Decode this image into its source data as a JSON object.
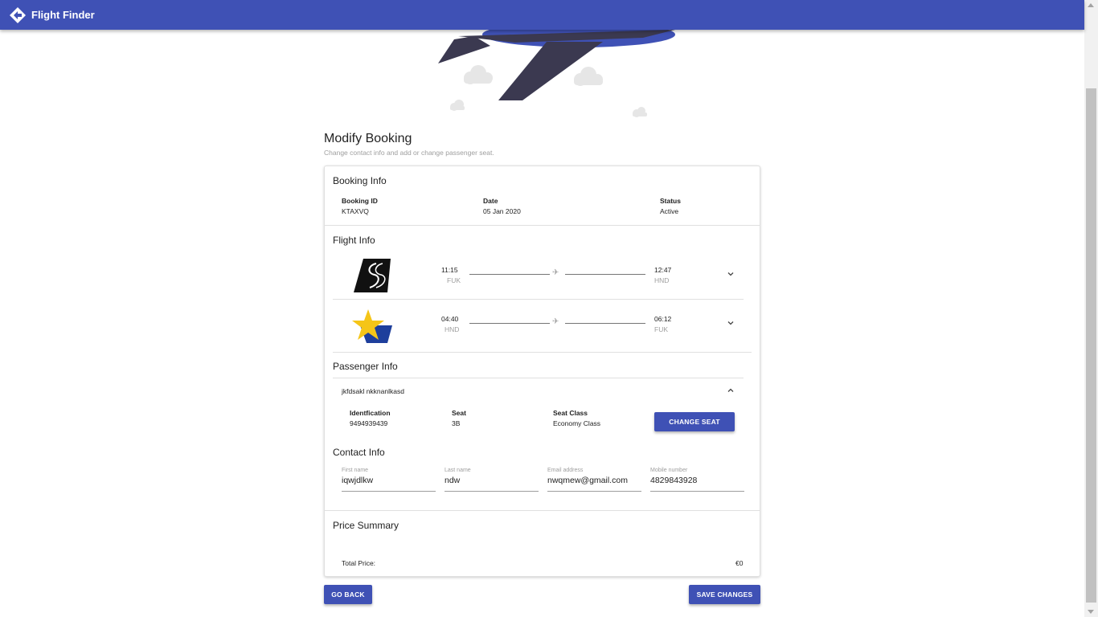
{
  "app": {
    "brand": "Flight Finder"
  },
  "page": {
    "title": "Modify Booking",
    "subtitle": "Change contact info and add or change passenger seat."
  },
  "booking": {
    "section_title": "Booking Info",
    "id_label": "Booking ID",
    "id_value": "KTAXVQ",
    "date_label": "Date",
    "date_value": "05 Jan 2020",
    "status_label": "Status",
    "status_value": "Active"
  },
  "flights": {
    "section_title": "Flight Info",
    "items": [
      {
        "depart_time": "11:15",
        "depart_code": "FUK",
        "arrive_time": "12:47",
        "arrive_code": "HND",
        "logo": "tail-logo-icon"
      },
      {
        "depart_time": "04:40",
        "depart_code": "HND",
        "arrive_time": "06:12",
        "arrive_code": "FUK",
        "logo": "star-logo-icon"
      }
    ]
  },
  "passenger": {
    "section_title": "Passenger Info",
    "name": "jkfdsakl nkknanlkasd",
    "id_label": "Identfication",
    "id_value": "9494939439",
    "seat_label": "Seat",
    "seat_value": "3B",
    "class_label": "Seat Class",
    "class_value": "Economy Class",
    "change_seat_label": "Change Seat"
  },
  "contact": {
    "section_title": "Contact Info",
    "first_name_label": "First name",
    "first_name_value": "iqwjdlkw",
    "last_name_label": "Last name",
    "last_name_value": "ndw",
    "email_label": "Email address",
    "email_value": "nwqmew@gmail.com",
    "mobile_label": "Mobile number",
    "mobile_value": "4829843928"
  },
  "price": {
    "section_title": "Price Summary",
    "total_label": "Total Price:",
    "total_value": "€0"
  },
  "actions": {
    "go_back_label": "Go Back",
    "save_label": "Save Changes"
  },
  "colors": {
    "primary": "#3f51b5",
    "plane_dark": "#3b3950",
    "plane_blue": "#3f51b5",
    "star_yellow": "#f5c518",
    "star_blue": "#1e3f9c"
  }
}
